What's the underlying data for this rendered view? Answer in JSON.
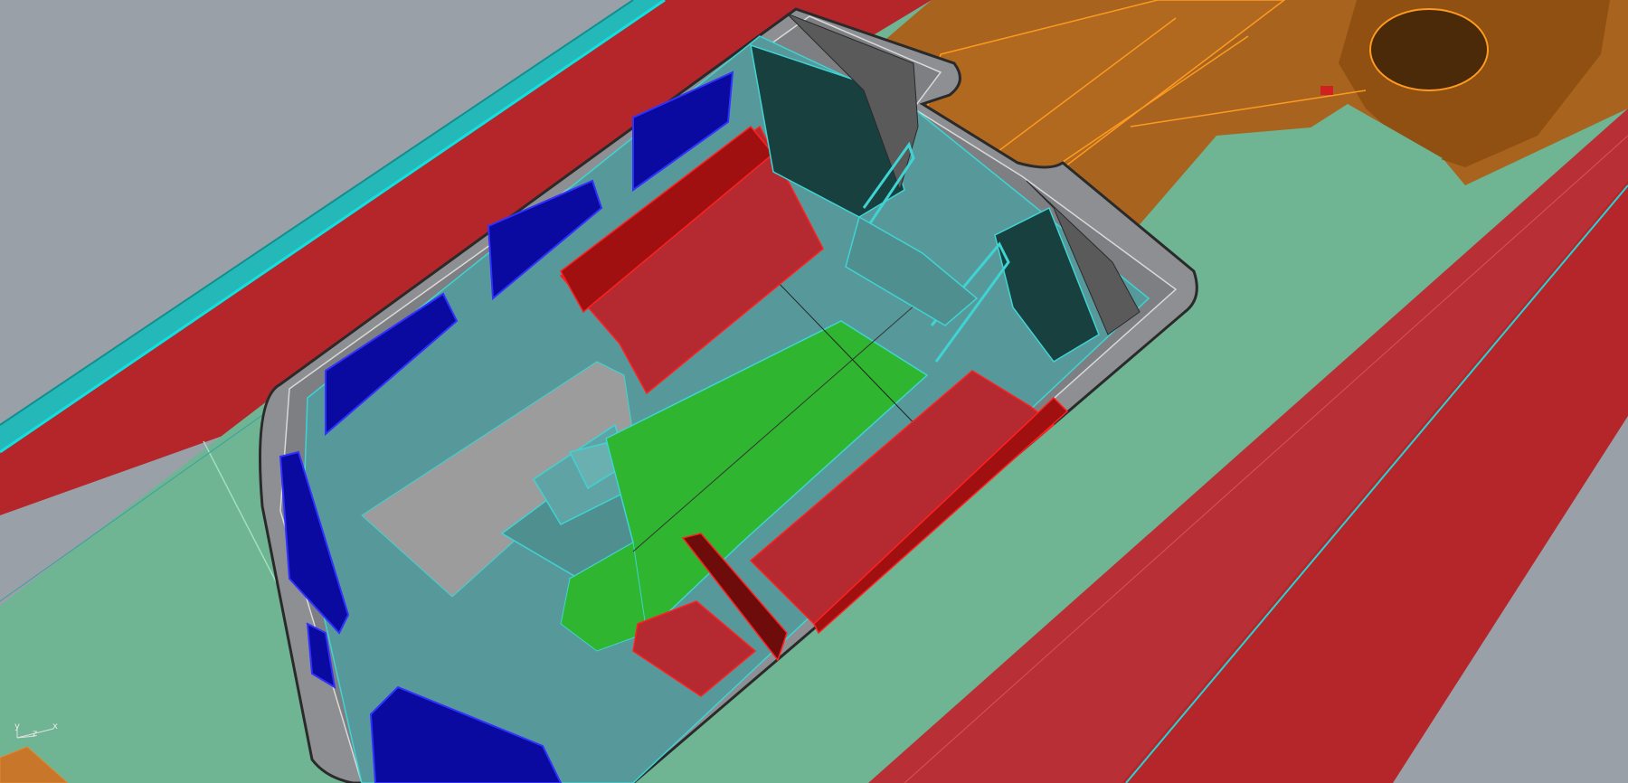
{
  "viewport": {
    "name": "Perspective",
    "background": "#9aa0a8"
  },
  "colors": {
    "hull_red": "#b5262b",
    "deck_green": "#6fb593",
    "cockpit_teal": "#57999a",
    "floor_green": "#2fb52f",
    "seat_red": "#b52a30",
    "window_blue": "#0a0aa0",
    "engine_orange": "#a8641e",
    "edge_cyan": "#20d0d0",
    "coaming_grey": "#8d8f92"
  },
  "gizmo": {
    "y_label": "y",
    "z_label": "z",
    "x_label": "x"
  }
}
